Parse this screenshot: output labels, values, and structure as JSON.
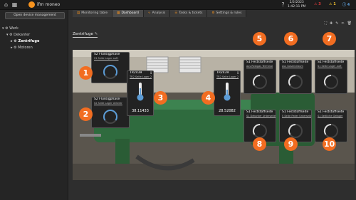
{
  "topbar": {
    "home_icon": "home-icon",
    "grid_icon": "grid-icon",
    "brand": "ifm moneo",
    "date": "2/2/2023",
    "time": "1:42:11 PM",
    "stat_red": "3",
    "stat_yellow": "1",
    "stat_blue": "4"
  },
  "sidebar": {
    "button_label": "Open device management",
    "tree": {
      "root": "Werk",
      "level1": "Dekanter",
      "level2_selected": "Zentrifuge",
      "level2": "Motoren"
    }
  },
  "tabs": [
    {
      "label": "Monitoring table"
    },
    {
      "label": "Dashboard"
    },
    {
      "label": "Analysis"
    },
    {
      "label": "Tasks & tickets"
    },
    {
      "label": "Settings & rules"
    }
  ],
  "page_title": "Zentrifuge",
  "panels": {
    "p1": {
      "title": "S2 Flüssigphase",
      "sub": "S1 Seite Lager auff."
    },
    "p2": {
      "title": "S2 Flüssigphase",
      "sub": "S2 Seite Lager Unterer"
    },
    "p3": {
      "title": "TR2439",
      "sub": "TR2 Seite Lager 2",
      "value": "38.11433"
    },
    "p4": {
      "title": "TR2439",
      "sub": "TR2 Seite Lager 2",
      "value": "28.52082"
    },
    "p5": {
      "title": "S1 Feststoffseite",
      "sub": "aus Restgas Terminal"
    },
    "p6": {
      "title": "S1 Feststoffseite",
      "sub": "aus Gasendraum"
    },
    "p7": {
      "title": "S1 Feststoffseite",
      "sub": "S1 Seite Lager auff."
    },
    "p8": {
      "title": "S1 Feststoffseite",
      "sub": "S1 Dekanter Unterseite"
    },
    "p9": {
      "title": "S1 Feststoffseite",
      "sub": "S Seite Feder Unterseite"
    },
    "p10": {
      "title": "S1 Feststoffseite",
      "sub": "S1 Seitliche Gelager"
    }
  },
  "markers": [
    "1",
    "2",
    "3",
    "4",
    "5",
    "6",
    "7",
    "8",
    "9",
    "10"
  ],
  "colors": {
    "accent": "#f26d21",
    "brand": "#f7931e",
    "gauge": "#5b9bd5"
  }
}
